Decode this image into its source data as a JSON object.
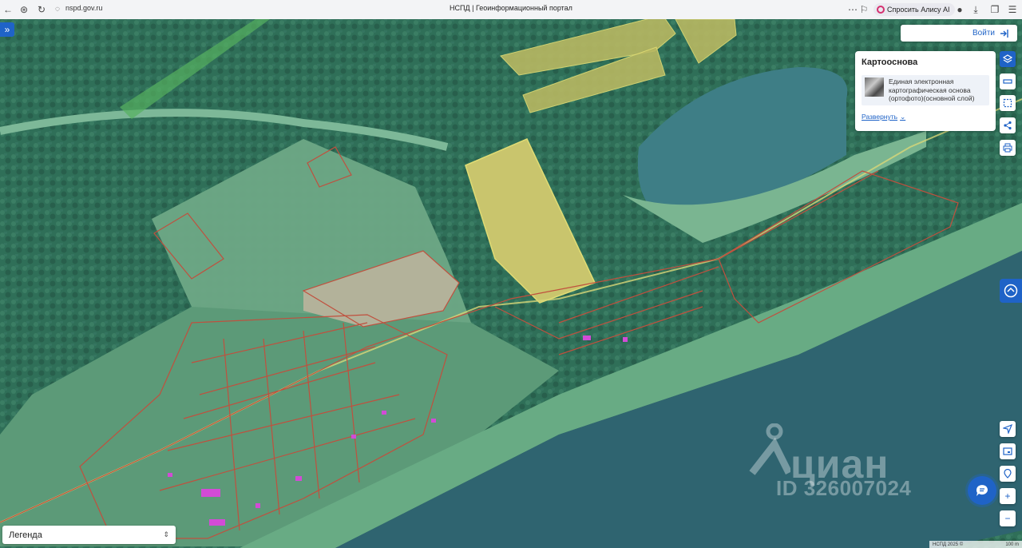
{
  "browser": {
    "url": "nspd.gov.ru",
    "tab_title": "НСПД | Геоинформационный портал",
    "alice_label": "Спросить Алису AI"
  },
  "header": {
    "login_label": "Войти"
  },
  "basemap_panel": {
    "title": "Картооснова",
    "layer_name": "Единая электронная картографическая основа (ортофото)(основной слой)",
    "expand_label": "Развернуть"
  },
  "legend": {
    "label": "Легенда"
  },
  "watermark": {
    "brand": "циан",
    "id_text": "ID 326007024"
  },
  "scale": {
    "copyright": "НСПД 2025 ©",
    "distance": "100 m"
  },
  "colors": {
    "accent": "#1f63c7",
    "forest": "#2f6f58",
    "meadow": "#6aaa86",
    "river": "#2f6470",
    "parcel_yellow": "#d8d86a",
    "boundary_red": "#c0503e"
  },
  "icons": {
    "sidebar_toggle": "double-chevron-right-icon",
    "layers": "layers-icon",
    "ruler": "ruler-icon",
    "select_area": "select-area-icon",
    "share": "share-icon",
    "print": "print-icon",
    "locate": "locate-arrow-icon",
    "gallery": "gallery-icon",
    "pin": "pin-icon",
    "chat": "chat-icon",
    "zoom_in": "plus-icon",
    "zoom_out": "minus-icon"
  }
}
